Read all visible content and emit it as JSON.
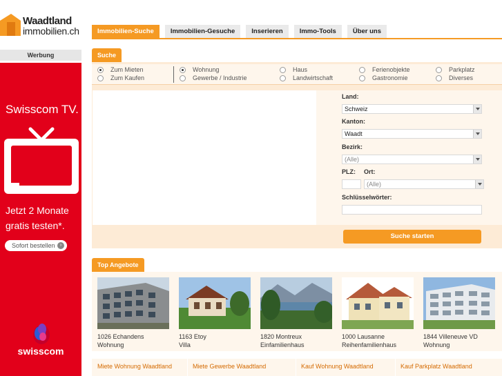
{
  "logo": {
    "line1": "Waadtland",
    "line2": "immobilien.ch"
  },
  "nav": {
    "tabs": [
      {
        "label": "Immobilien-Suche",
        "active": true
      },
      {
        "label": "Immobilien-Gesuche",
        "active": false
      },
      {
        "label": "Inserieren",
        "active": false
      },
      {
        "label": "Immo-Tools",
        "active": false
      },
      {
        "label": "Über uns",
        "active": false
      }
    ]
  },
  "ad": {
    "label": "Werbung",
    "title": "Swisscom TV.",
    "offer_line1": "Jetzt 2 Monate",
    "offer_line2": "gratis testen*.",
    "button": "Sofort bestellen",
    "brand": "swisscom"
  },
  "search": {
    "header": "Suche",
    "mode": {
      "rent": "Zum Mieten",
      "buy": "Zum Kaufen",
      "selected": "rent"
    },
    "types": {
      "wohnung": "Wohnung",
      "gewerbe": "Gewerbe / Industrie",
      "haus": "Haus",
      "landwirtschaft": "Landwirtschaft",
      "ferienobjekte": "Ferienobjekte",
      "gastronomie": "Gastronomie",
      "parkplatz": "Parkplatz",
      "diverses": "Diverses",
      "selected": "wohnung"
    },
    "land_label": "Land:",
    "land_value": "Schweiz",
    "kanton_label": "Kanton:",
    "kanton_value": "Waadt",
    "bezirk_label": "Bezirk:",
    "bezirk_value": "(Alle)",
    "plz_label": "PLZ:",
    "ort_label": "Ort:",
    "ort_value": "(Alle)",
    "keywords_label": "Schlüsselwörter:",
    "submit": "Suche starten"
  },
  "offers": {
    "header": "Top Angebote",
    "items": [
      {
        "place": "1026 Echandens",
        "type": "Wohnung"
      },
      {
        "place": "1163 Etoy",
        "type": "Villa"
      },
      {
        "place": "1820 Montreux",
        "type": "Einfamilienhaus"
      },
      {
        "place": "1000 Lausanne",
        "type": "Reihenfamilienhaus"
      },
      {
        "place": "1844 Villeneuve VD",
        "type": "Wohnung"
      }
    ]
  },
  "footer_links": [
    "Miete Wohnung  Waadtland",
    "Miete Gewerbe Waadtland",
    "Kauf Wohnung Waadtland",
    "Kauf Parkplatz Waadtland"
  ],
  "colors": {
    "accent": "#f59a23",
    "ad_red": "#e2001a",
    "panel": "#fef6ec",
    "link": "#d46a00"
  }
}
